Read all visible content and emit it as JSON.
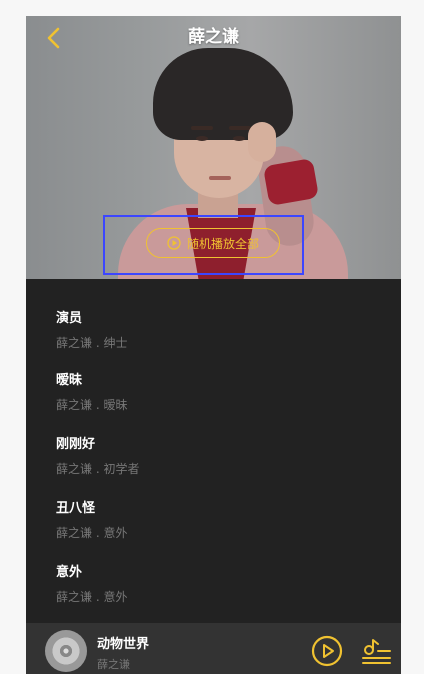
{
  "header": {
    "title": "薛之谦"
  },
  "hero": {
    "play_all_label": "随机播放全部"
  },
  "songs": [
    {
      "title": "演员",
      "subtitle": "薛之谦 . 绅士"
    },
    {
      "title": "暧昧",
      "subtitle": "薛之谦 . 暧昧"
    },
    {
      "title": "刚刚好",
      "subtitle": "薛之谦 . 初学者"
    },
    {
      "title": "丑八怪",
      "subtitle": "薛之谦 . 意外"
    },
    {
      "title": "意外",
      "subtitle": "薛之谦 . 意外"
    }
  ],
  "now_playing": {
    "title": "动物世界",
    "artist": "薛之谦"
  },
  "colors": {
    "accent": "#f0c231",
    "background": "#222222",
    "player_bar": "#333333"
  },
  "icons": [
    "back-chevron-icon",
    "play-circle-icon",
    "playlist-icon"
  ]
}
